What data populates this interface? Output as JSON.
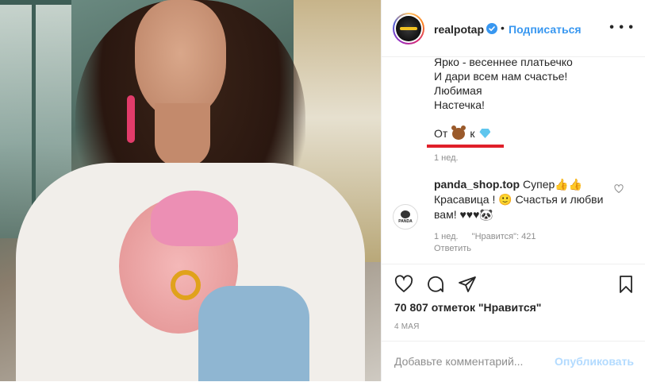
{
  "post": {
    "username": "realpotap",
    "follow_label": "Подписаться",
    "dot": "•",
    "more_label": "• • •",
    "caption_lines": [
      "Ярко - весеннее платьечко",
      "И дари всем нам счастье!",
      "Любимая",
      "Настечка!"
    ],
    "emoji_line_from": "От",
    "emoji_line_to": "к",
    "emoji_icons": [
      "bear-face-icon",
      "gem-icon"
    ],
    "time_ago": "1 нед."
  },
  "comment": {
    "username": "panda_shop.top",
    "text_part1": "Супер👍👍",
    "text_part2": "Красавица ! 🙂 Счастья и любви вам! ♥♥♥🐼",
    "avatar_text": "PANDA",
    "time_ago": "1 нед.",
    "likes": "\"Нравится\": 421",
    "reply_label": "Ответить"
  },
  "actions": {
    "likes_text": "70 807 отметок \"Нравится\"",
    "date": "4 МАЯ",
    "comment_placeholder": "Добавьте комментарий...",
    "post_label": "Опубликовать"
  },
  "colors": {
    "accent": "#3897f0",
    "highlight_line": "#e0202a",
    "muted_text": "#8e8e8e"
  }
}
